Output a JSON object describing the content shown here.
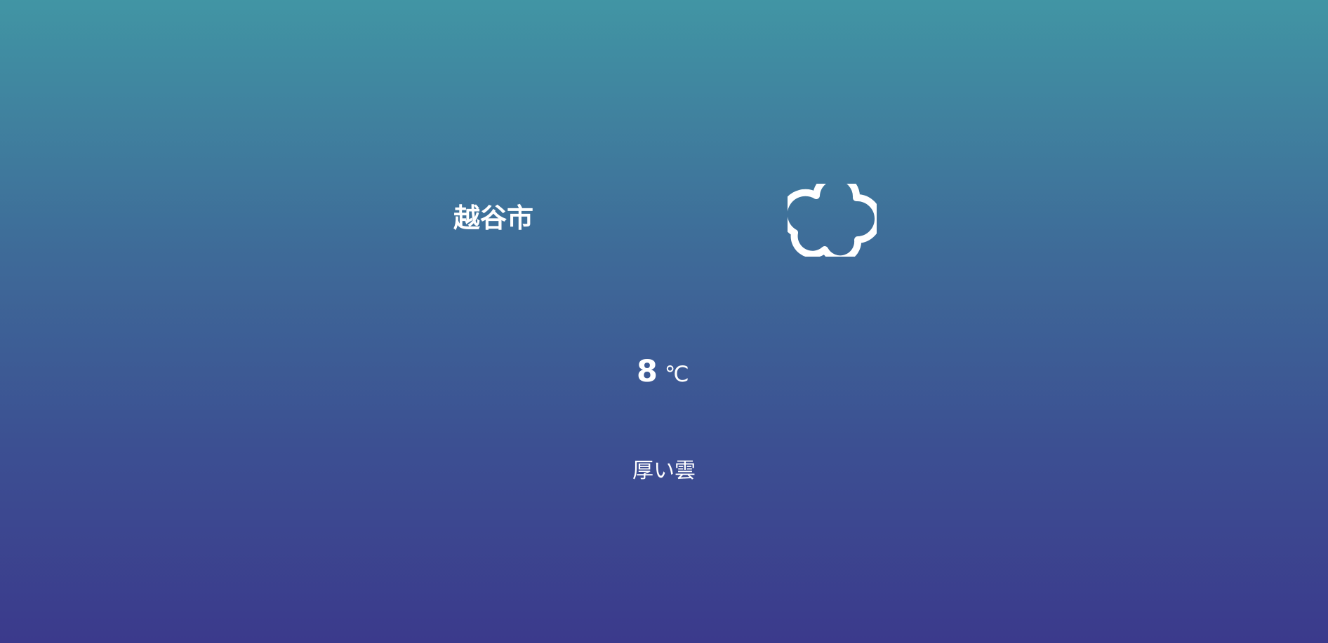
{
  "weather": {
    "city": "越谷市",
    "icon": "cloud-icon",
    "temperature": "8",
    "unit": "℃",
    "description": "厚い雲"
  },
  "colors": {
    "gradient_top": "#4195a4",
    "gradient_bottom": "#3b3a8c",
    "text": "#ffffff"
  }
}
